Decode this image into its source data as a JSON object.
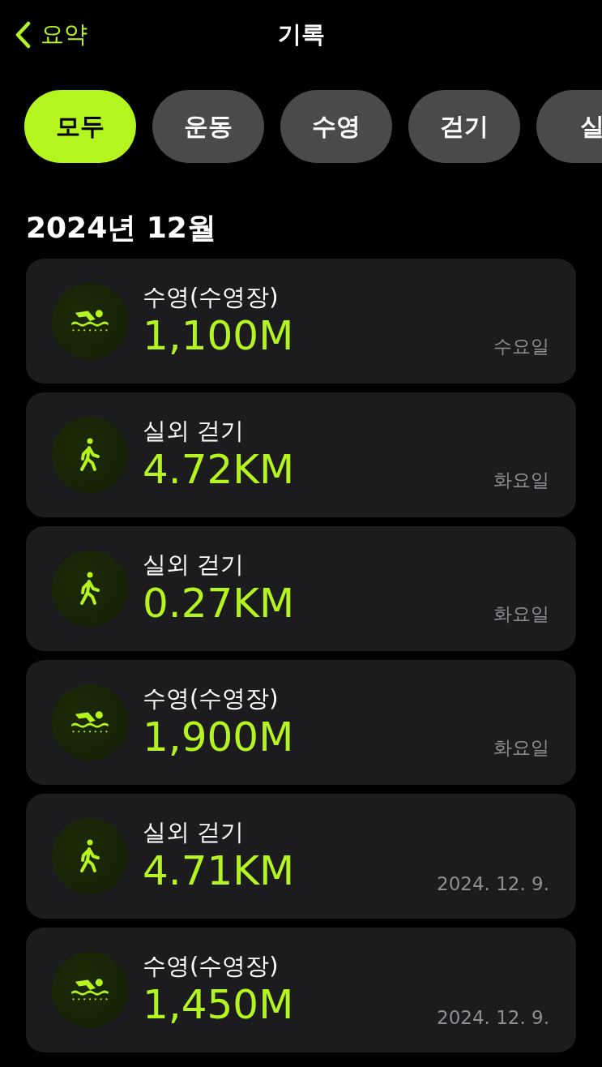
{
  "nav": {
    "back_label": "요약",
    "title": "기록"
  },
  "filters": [
    {
      "label": "모두",
      "selected": true
    },
    {
      "label": "운동",
      "selected": false
    },
    {
      "label": "수영",
      "selected": false
    },
    {
      "label": "걷기",
      "selected": false
    },
    {
      "label": "실",
      "selected": false
    }
  ],
  "section_title": "2024년 12월",
  "workouts": [
    {
      "kind": "swim",
      "name": "수영(수영장)",
      "distance": "1,100M",
      "date": "수요일"
    },
    {
      "kind": "walk",
      "name": "실외 걷기",
      "distance": "4.72KM",
      "date": "화요일"
    },
    {
      "kind": "walk",
      "name": "실외 걷기",
      "distance": "0.27KM",
      "date": "화요일"
    },
    {
      "kind": "swim",
      "name": "수영(수영장)",
      "distance": "1,900M",
      "date": "화요일"
    },
    {
      "kind": "walk",
      "name": "실외 걷기",
      "distance": "4.71KM",
      "date": "2024. 12. 9."
    },
    {
      "kind": "swim",
      "name": "수영(수영장)",
      "distance": "1,450M",
      "date": "2024. 12. 9."
    }
  ]
}
